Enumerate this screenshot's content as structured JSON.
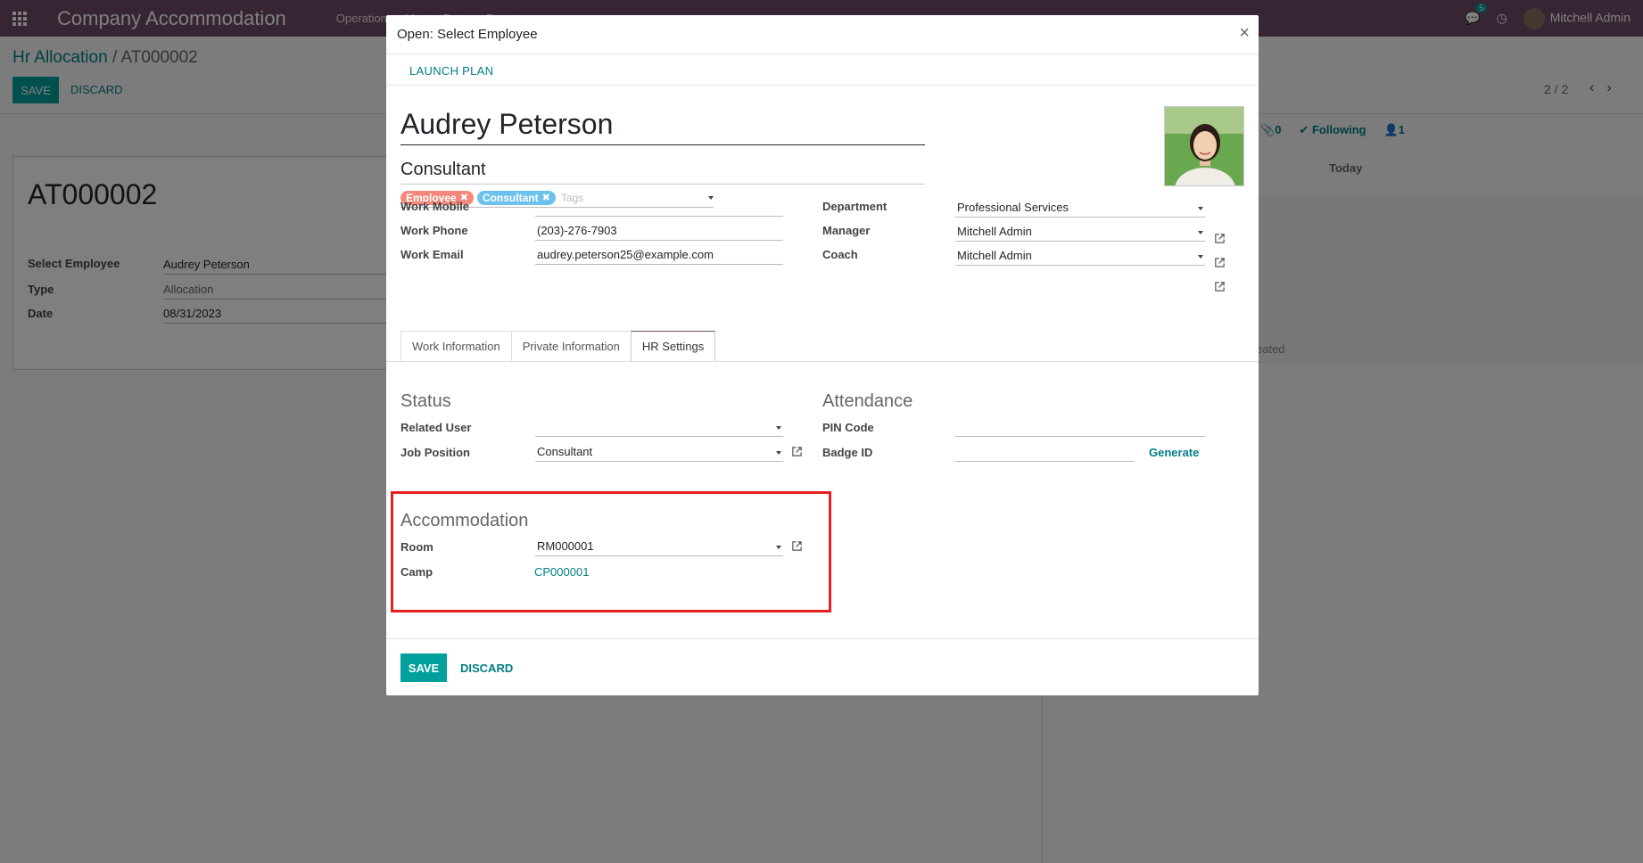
{
  "navbar": {
    "app_title": "Company Accommodation",
    "menus": [
      "Operation",
      "Master Data",
      "Report"
    ],
    "chat_count": "5",
    "user_name": "Mitchell Admin"
  },
  "background": {
    "breadcrumb_root": "Hr Allocation",
    "breadcrumb_sep": "/",
    "breadcrumb_current": "AT000002",
    "save_label": "SAVE",
    "discard_label": "DISCARD",
    "pager": "2 / 2",
    "record_title": "AT000002",
    "fields": [
      {
        "label": "Select Employee",
        "value": "Audrey Peterson"
      },
      {
        "label": "Type",
        "value": "Allocation"
      },
      {
        "label": "Date",
        "value": "08/31/2023"
      }
    ],
    "chatter": {
      "attachments": "0",
      "following": "Following",
      "followers": "1",
      "today": "Today",
      "created_suffix": "eated"
    }
  },
  "modal": {
    "title": "Open: Select Employee",
    "close_glyph": "×",
    "launch_plan": "LAUNCH PLAN",
    "employee_name": "Audrey Peterson",
    "job_title": "Consultant",
    "tags": [
      "Employee",
      "Consultant"
    ],
    "tags_placeholder": "Tags",
    "left_fields": [
      {
        "label": "Work Mobile",
        "value": ""
      },
      {
        "label": "Work Phone",
        "value": "(203)-276-7903"
      },
      {
        "label": "Work Email",
        "value": "audrey.peterson25@example.com"
      }
    ],
    "right_fields": [
      {
        "label": "Department",
        "value": "Professional Services"
      },
      {
        "label": "Manager",
        "value": "Mitchell Admin"
      },
      {
        "label": "Coach",
        "value": "Mitchell Admin"
      }
    ],
    "tabs": [
      "Work Information",
      "Private Information",
      "HR Settings"
    ],
    "active_tab": "HR Settings",
    "status": {
      "title": "Status",
      "related_user_label": "Related User",
      "related_user_value": "",
      "job_position_label": "Job Position",
      "job_position_value": "Consultant"
    },
    "attendance": {
      "title": "Attendance",
      "pin_label": "PIN Code",
      "pin_value": "",
      "badge_label": "Badge ID",
      "badge_value": "",
      "generate_label": "Generate"
    },
    "accommodation": {
      "title": "Accommodation",
      "room_label": "Room",
      "room_value": "RM000001",
      "camp_label": "Camp",
      "camp_value": "CP000001"
    },
    "save_label": "SAVE",
    "discard_label": "DISCARD"
  },
  "colors": {
    "navbar": "#714b67",
    "primary": "#00a09d",
    "link": "#017e84",
    "highlight": "#e62020"
  }
}
